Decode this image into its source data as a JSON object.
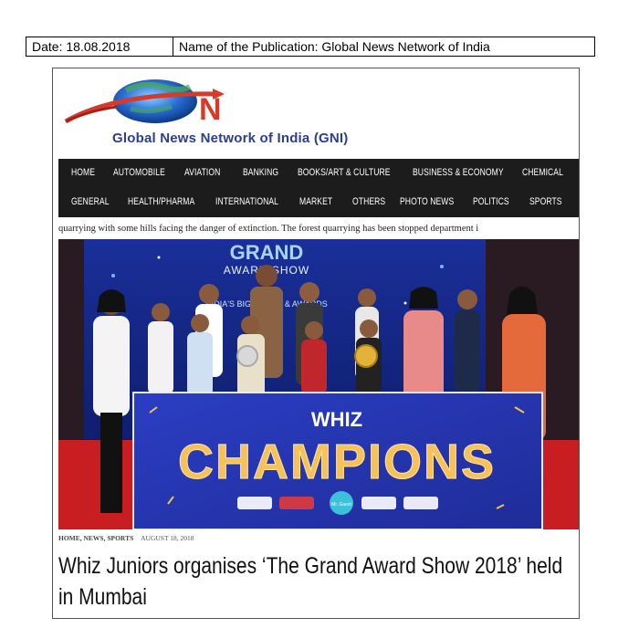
{
  "meta": {
    "date_label": "Date: 18.08.2018",
    "publication_label": "Name of the Publication: Global News Network of India"
  },
  "logo": {
    "letter": "N",
    "name": "Global News Network of India (GNI)",
    "colors": {
      "globe": "#2a6fd6",
      "swoosh": "#d63b2a",
      "text": "#2c3e8f"
    }
  },
  "nav": {
    "row1": [
      "HOME",
      "AUTOMOBILE",
      "AVIATION",
      "BANKING",
      "BOOKS/ART & CULTURE",
      "BUSINESS & ECONOMY",
      "CHEMICAL"
    ],
    "row2": [
      "GENERAL",
      "HEALTH/PHARMA",
      "INTERNATIONAL",
      "MARKET",
      "OTHERS",
      "PHOTO NEWS",
      "POLITICS",
      "SPORTS"
    ],
    "background": "#1c1c1c"
  },
  "ticker": "quarrying with some hills facing the danger of extinction. The forest quarrying has been stopped department i",
  "photo": {
    "backdrop_title": "GRAND",
    "backdrop_subtitle": "AWARD SHOW",
    "backdrop_line": "INDIA'S BIGGEST ... & AWARDS",
    "banner_top": "WHIZ",
    "banner_main": "CHAMPIONS",
    "banner_center_badge": "Mr. Guest"
  },
  "article": {
    "categories": "HOME, NEWS, SPORTS",
    "date": "AUGUST 18, 2018",
    "headline": "Whiz Juniors organises ‘The Grand Award Show 2018’ held in Mumbai"
  }
}
